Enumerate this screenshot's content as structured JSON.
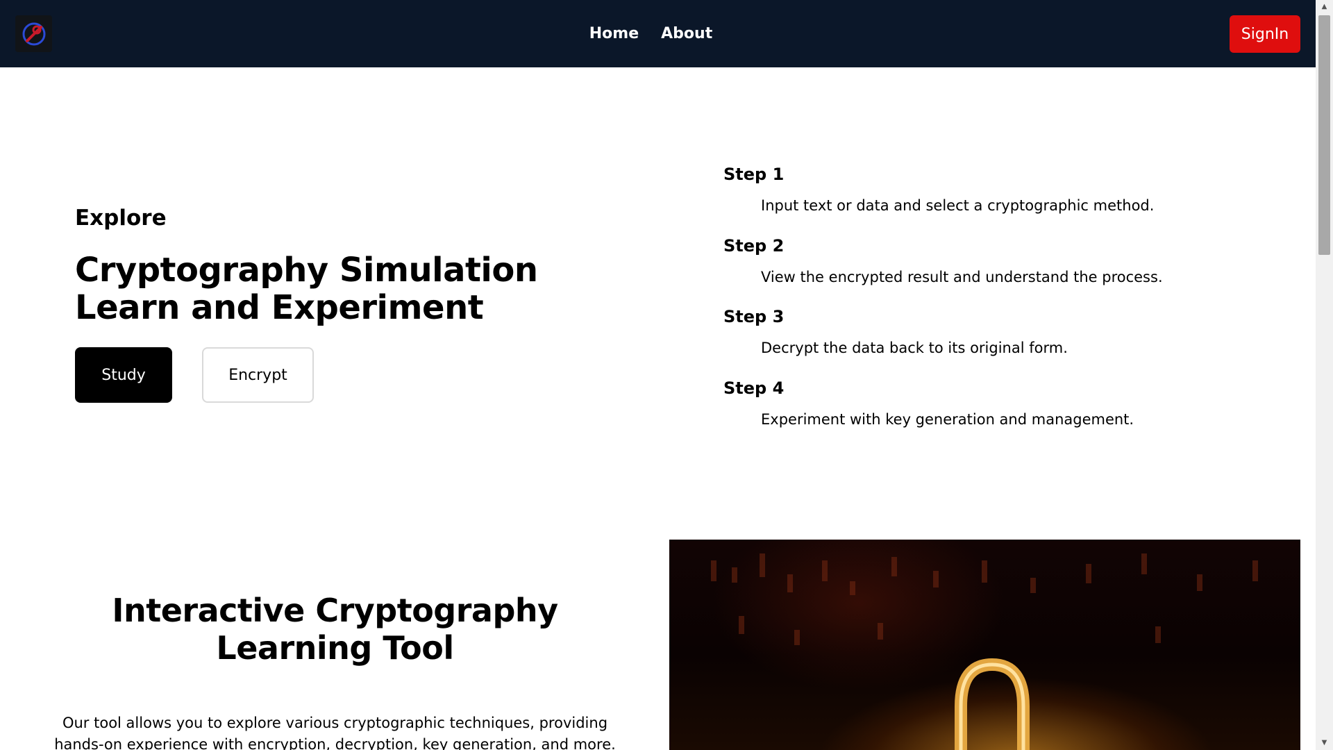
{
  "header": {
    "logo_alt": "logo-icon",
    "nav": [
      {
        "label": "Home"
      },
      {
        "label": "About"
      }
    ],
    "signin_label": "SignIn",
    "colors": {
      "background": "#0b1729",
      "signin": "#df0e0e"
    }
  },
  "hero": {
    "eyebrow": "Explore",
    "title_line1": "Cryptography Simulation",
    "title_line2": "Learn and Experiment",
    "study_label": "Study",
    "encrypt_label": "Encrypt"
  },
  "steps": [
    {
      "title": "Step 1",
      "description": "Input text or data and select a cryptographic method."
    },
    {
      "title": "Step 2",
      "description": "View the encrypted result and understand the process."
    },
    {
      "title": "Step 3",
      "description": "Decrypt the data back to its original form."
    },
    {
      "title": "Step 4",
      "description": "Experiment with key generation and management."
    }
  ],
  "feature": {
    "title": "Interactive Cryptography Learning Tool",
    "description": "Our tool allows you to explore various cryptographic techniques, providing hands-on experience with encryption, decryption, key generation, and more.",
    "image_icon": "padlock-on-keyboard-image"
  }
}
